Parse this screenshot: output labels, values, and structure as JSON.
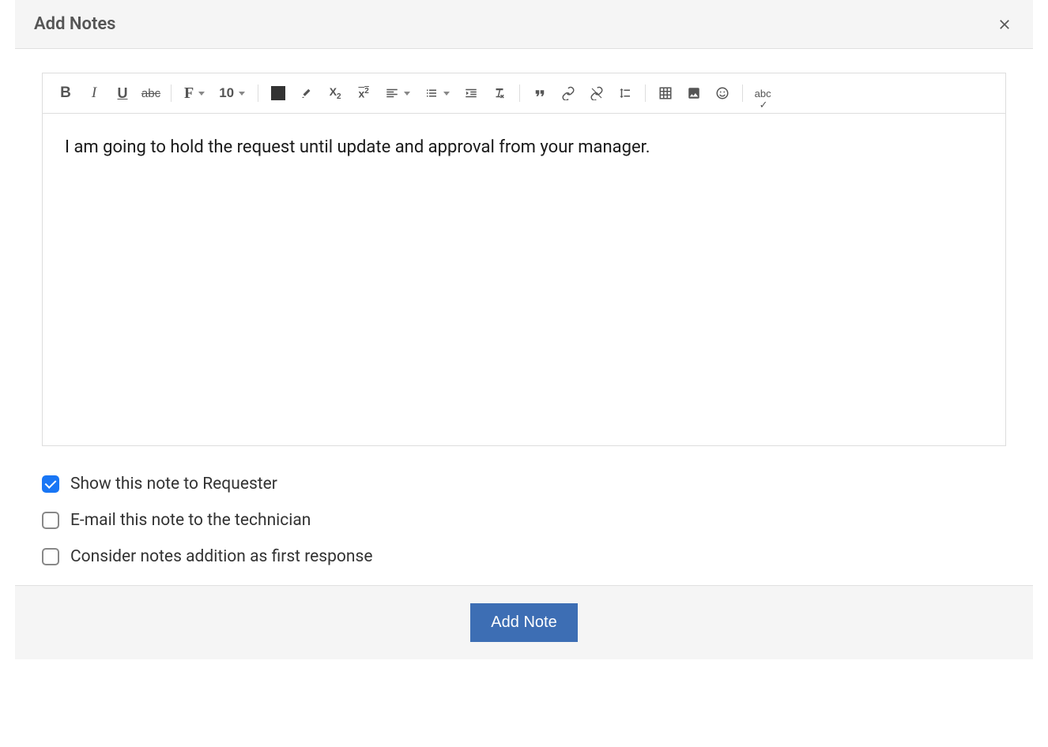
{
  "header": {
    "title": "Add Notes"
  },
  "toolbar": {
    "font_size": "10"
  },
  "editor": {
    "content": "I am going to hold the request until update and approval from your manager."
  },
  "options": {
    "show_requester": {
      "label": "Show this note to Requester",
      "checked": true
    },
    "email_tech": {
      "label": "E-mail this note to the technician",
      "checked": false
    },
    "first_response": {
      "label": "Consider notes addition as first response",
      "checked": false
    }
  },
  "footer": {
    "add_button": "Add Note"
  }
}
